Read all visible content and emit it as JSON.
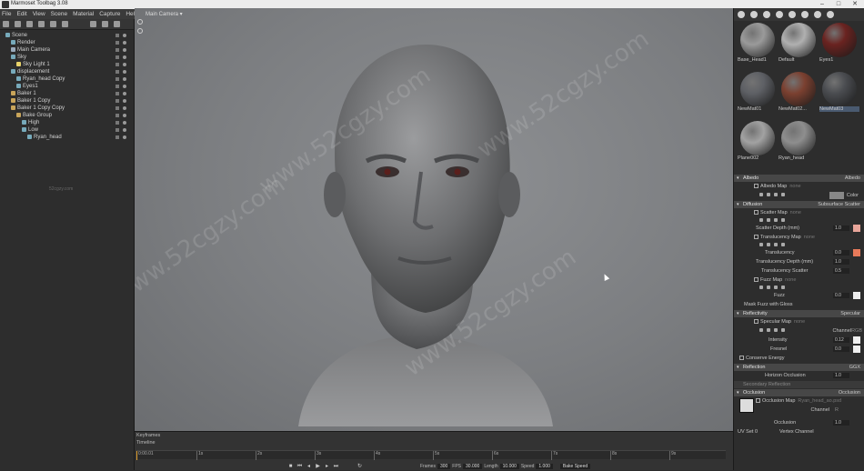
{
  "window": {
    "title": "Marmoset Toolbag 3.08"
  },
  "menu": [
    "File",
    "Edit",
    "View",
    "Scene",
    "Material",
    "Capture",
    "Help"
  ],
  "viewport": {
    "camera_label": "Main Camera ▾"
  },
  "watermark": "www.52cgzy.com",
  "scene_tree": [
    {
      "label": "Scene",
      "icon": "scene-icon",
      "indent": 0
    },
    {
      "label": "Render",
      "icon": "render-icon",
      "indent": 1
    },
    {
      "label": "Main Camera",
      "icon": "camera-icon",
      "indent": 1
    },
    {
      "label": "Sky",
      "icon": "sky-icon",
      "indent": 1
    },
    {
      "label": "Sky Light 1",
      "icon": "light-icon",
      "indent": 2
    },
    {
      "label": "displacement",
      "icon": "mesh-icon",
      "indent": 1
    },
    {
      "label": "Ryan_head Copy",
      "icon": "mesh-icon",
      "indent": 2
    },
    {
      "label": "Eyes1",
      "icon": "mesh-icon",
      "indent": 2
    },
    {
      "label": "Baker 1",
      "icon": "folder-icon",
      "indent": 1
    },
    {
      "label": "Baker 1 Copy",
      "icon": "folder-icon",
      "indent": 1
    },
    {
      "label": "Baker 1 Copy Copy",
      "icon": "folder-icon",
      "indent": 1
    },
    {
      "label": "Bake Group",
      "icon": "folder-icon",
      "indent": 2
    },
    {
      "label": "High",
      "icon": "mesh-icon",
      "indent": 3
    },
    {
      "label": "Low",
      "icon": "mesh-icon",
      "indent": 3
    },
    {
      "label": "Ryan_head",
      "icon": "mesh-icon",
      "indent": 4
    }
  ],
  "left_watermark": "52cgzy.com",
  "materials": [
    {
      "name": "Base_Head1",
      "color": "#9a9a9a"
    },
    {
      "name": "Default",
      "color": "#b0b0b0"
    },
    {
      "name": "Eyes1",
      "color": "#6a2320"
    },
    {
      "name": "NewMat01",
      "color": "#5e6065"
    },
    {
      "name": "NewMat02...",
      "color": "#7b4030"
    },
    {
      "name": "NewMat03",
      "color": "#4a4c50",
      "selected": true
    },
    {
      "name": "Plane002",
      "color": "#a2a2a2"
    },
    {
      "name": "Ryan_head",
      "color": "#8e8e8e"
    }
  ],
  "properties": {
    "albedo": {
      "title": "Albedo",
      "mode": "Albedo",
      "map_label": "Albedo Map",
      "map_value": "none",
      "color_label": "Color"
    },
    "diffusion": {
      "title": "Diffusion",
      "mode": "Subsurface Scatter",
      "scatter_map": "Scatter Map",
      "scatter_map_value": "none",
      "scatter_depth_label": "Scatter Depth (mm)",
      "scatter_depth": "1.0",
      "translucency_map": "Translucency Map",
      "translucency_map_value": "none",
      "translucency_label": "Translucency",
      "translucency": "0.0",
      "translucency_depth_label": "Translucency Depth (mm)",
      "translucency_depth": "1.0",
      "translucency_scatter_label": "Translucency Scatter",
      "translucency_scatter": "0.5",
      "fuzz_map": "Fuzz Map",
      "fuzz_map_value": "none",
      "fuzz_label": "Fuzz",
      "fuzz": "0.0",
      "mask_fuzz_label": "Mask Fuzz with Gloss"
    },
    "reflectivity": {
      "title": "Reflectivity",
      "mode": "Specular",
      "specular_map": "Specular Map",
      "specular_map_value": "none",
      "channel_label": "Channel",
      "channel_value": "RGB",
      "intensity_label": "Intensity",
      "intensity": "0.12",
      "fresnel_label": "Fresnel",
      "fresnel": "0.0",
      "conserve_energy_label": "Conserve Energy"
    },
    "reflection": {
      "title": "Reflection",
      "mode": "GGX",
      "horizon_label": "Horizon Occlusion",
      "horizon": "1.0"
    },
    "secondary": {
      "title": "Secondary Reflection"
    },
    "occlusion": {
      "title": "Occlusion",
      "mode": "Occlusion",
      "map_label": "Occlusion Map",
      "map_value": "Ryan_head_ao.psd",
      "channel_label": "Channel",
      "channel_value": "R",
      "occlusion_label": "Occlusion",
      "occlusion": "1.0",
      "uv_set_label": "UV Set",
      "uv_set_value": "0",
      "vertex_channel_label": "Vertex Channel"
    }
  },
  "timeline": {
    "keyframes_label": "Keyframes",
    "timeline_label": "Timeline",
    "time": "0:00.01",
    "ticks": [
      "1s",
      "2s",
      "3s",
      "4s",
      "5s",
      "6s",
      "7s",
      "8s",
      "9s"
    ],
    "frames_label": "Frames",
    "frames": "300",
    "fps_label": "FPS",
    "fps": "30.000",
    "length_label": "Length",
    "length": "10.000",
    "speed_label": "Speed",
    "speed": "1.000",
    "bake_speed_label": "Bake Speed"
  }
}
